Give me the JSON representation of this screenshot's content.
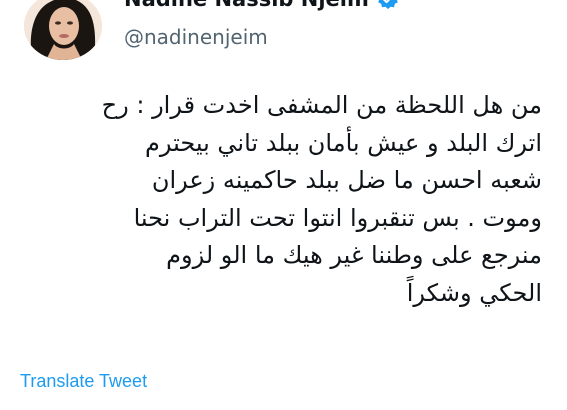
{
  "author": {
    "display_name": "Nadine Nassib Njeim",
    "handle": "@nadinenjeim",
    "verified_icon": "verified-badge-icon",
    "verified_color": "#1d9bf0"
  },
  "tweet": {
    "lines": [
      "من هل اللحظة من المشفى اخدت قرار : رح",
      "اترك البلد و عيش بأمان ببلد تاني بيحترم",
      "شعبه احسن ما ضل ببلد حاكمينه زعران",
      "وموت . بس تنقبروا انتوا تحت التراب نحنا",
      "منرجع على وطننا غير هيك ما الو لزوم",
      "الحكي وشكراً"
    ]
  },
  "actions": {
    "translate_label": "Translate Tweet",
    "link_color": "#1d9bf0"
  }
}
